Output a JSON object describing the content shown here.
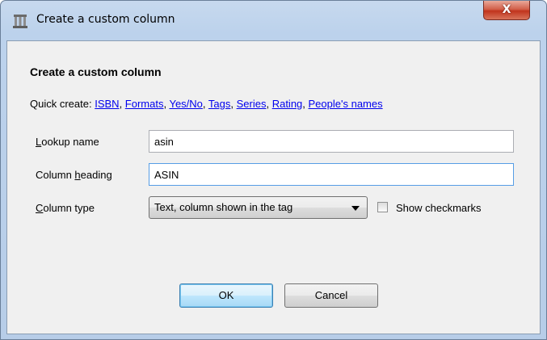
{
  "window": {
    "title": "Create a custom column",
    "close_label": "X"
  },
  "form": {
    "heading": "Create a custom column",
    "quick_create": {
      "prefix": "Quick create:",
      "links": [
        "ISBN",
        "Formats",
        "Yes/No",
        "Tags",
        "Series",
        "Rating",
        "People's names"
      ]
    },
    "lookup_name": {
      "label_mnemonic": "L",
      "label_rest": "ookup name",
      "value": "asin"
    },
    "column_heading": {
      "label_pre": "Column ",
      "label_mnemonic": "h",
      "label_rest": "eading",
      "value": "ASIN"
    },
    "column_type": {
      "label_mnemonic": "C",
      "label_rest": "olumn type",
      "selected": "Text, column shown in the tag"
    },
    "show_checkmarks": {
      "label": "Show checkmarks",
      "checked": false
    }
  },
  "buttons": {
    "ok": "OK",
    "cancel": "Cancel"
  }
}
